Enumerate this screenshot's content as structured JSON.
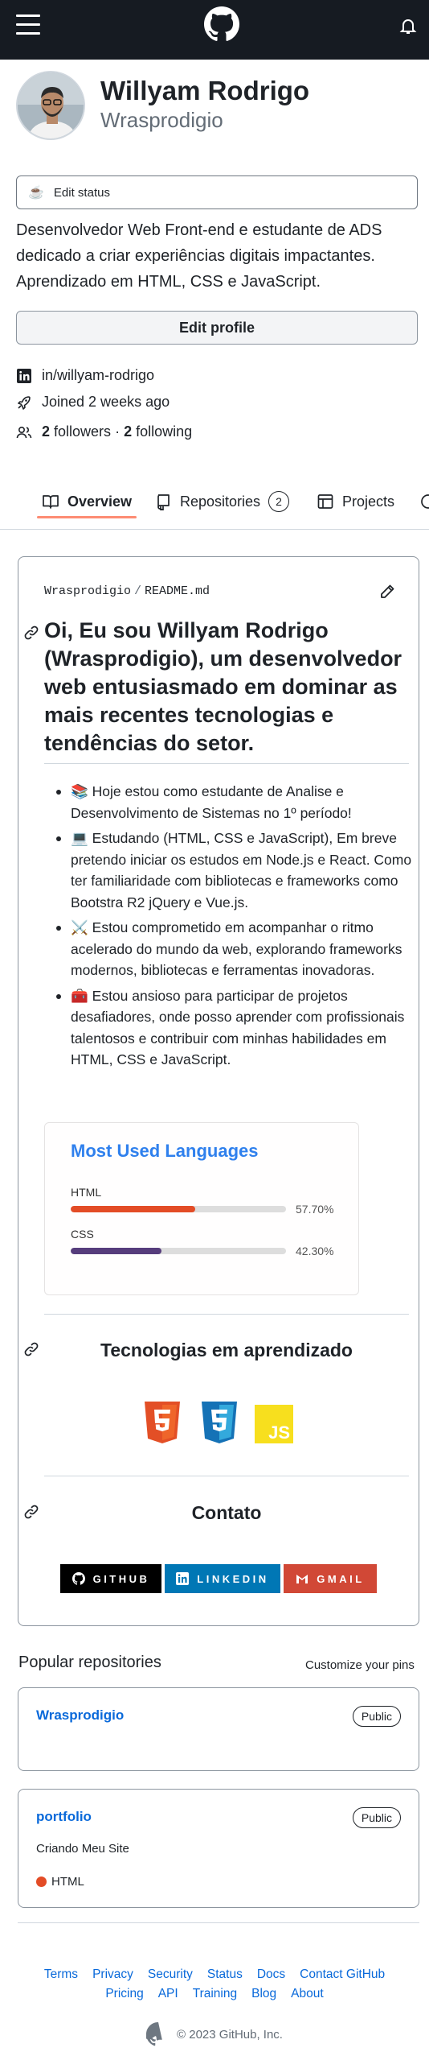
{
  "header": {
    "menu_icon": "hamburger-icon",
    "logo_icon": "github-logo-icon",
    "notifications_icon": "bell-icon"
  },
  "profile": {
    "display_name": "Willyam Rodrigo",
    "username": "Wrasprodigio",
    "status_emoji": "☕",
    "status_label": "Edit status",
    "bio": "Desenvolvedor Web Front-end e estudante de ADS dedicado a criar experiências digitais impactantes. Aprendizado em HTML, CSS e JavaScript.",
    "edit_profile_label": "Edit profile",
    "linkedin": "in/willyam-rodrigo",
    "joined": "Joined 2 weeks ago",
    "followers_count": "2",
    "followers_label": "followers",
    "separator": "·",
    "following_count": "2",
    "following_label": "following"
  },
  "tabs": [
    {
      "label": "Overview",
      "icon": "book-icon",
      "active": true
    },
    {
      "label": "Repositories",
      "icon": "repo-icon",
      "count": "2"
    },
    {
      "label": "Projects",
      "icon": "table-icon"
    }
  ],
  "readme": {
    "owner": "Wrasprodigio",
    "path_separator": "/",
    "file": "README.md",
    "heading": "Oi, Eu sou Willyam Rodrigo (Wrasprodigio), um desenvolvedor web entusiasmado em dominar as mais recentes tecnologias e tendências do setor.",
    "items": [
      "📚 Hoje estou como estudante de Analise e Desenvolvimento de Sistemas no 1º período!",
      "💻 Estudando (HTML, CSS e JavaScript), Em breve pretendo iniciar os estudos em Node.js e React. Como ter familiaridade com bibliotecas e frameworks como Bootstra R2 jQuery e Vue.js.",
      "⚔️ Estou comprometido em acompanhar o ritmo acelerado do mundo da web, explorando frameworks modernos, bibliotecas e ferramentas inovadoras.",
      "🧰 Estou ansioso para participar de projetos desafiadores, onde posso aprender com profissionais talentosos e contribuir com minhas habilidades em HTML, CSS e JavaScript."
    ],
    "languages_card": {
      "title": "Most Used Languages",
      "languages": [
        {
          "name": "HTML",
          "percent": "57.70%",
          "value": 57.7,
          "color": "#e34c26"
        },
        {
          "name": "CSS",
          "percent": "42.30%",
          "value": 42.3,
          "color": "#563d7c"
        }
      ]
    },
    "tech_title": "Tecnologias em aprendizado",
    "tech_icons": [
      {
        "name": "html5",
        "label": "5",
        "color": "#e34f26"
      },
      {
        "name": "css3",
        "label": "3",
        "color": "#1572b6"
      },
      {
        "name": "javascript",
        "label": "JS",
        "color": "#f7df1e"
      }
    ],
    "contact_title": "Contato",
    "badges": [
      {
        "label": "GITHUB",
        "color": "#000000"
      },
      {
        "label": "LINKEDIN",
        "color": "#0077b5"
      },
      {
        "label": "GMAIL",
        "color": "#d14836"
      }
    ]
  },
  "popular": {
    "title": "Popular repositories",
    "customize_label": "Customize your pins",
    "repos": [
      {
        "name": "Wrasprodigio",
        "visibility": "Public",
        "description": "",
        "language": ""
      },
      {
        "name": "portfolio",
        "visibility": "Public",
        "description": "Criando Meu Site",
        "language": "HTML",
        "language_color": "#e34c26"
      }
    ]
  },
  "footer": {
    "row1": [
      "Terms",
      "Privacy",
      "Security",
      "Status",
      "Docs",
      "Contact GitHub"
    ],
    "row2": [
      "Pricing",
      "API",
      "Training",
      "Blog",
      "About"
    ],
    "copyright": "© 2023 GitHub, Inc."
  }
}
